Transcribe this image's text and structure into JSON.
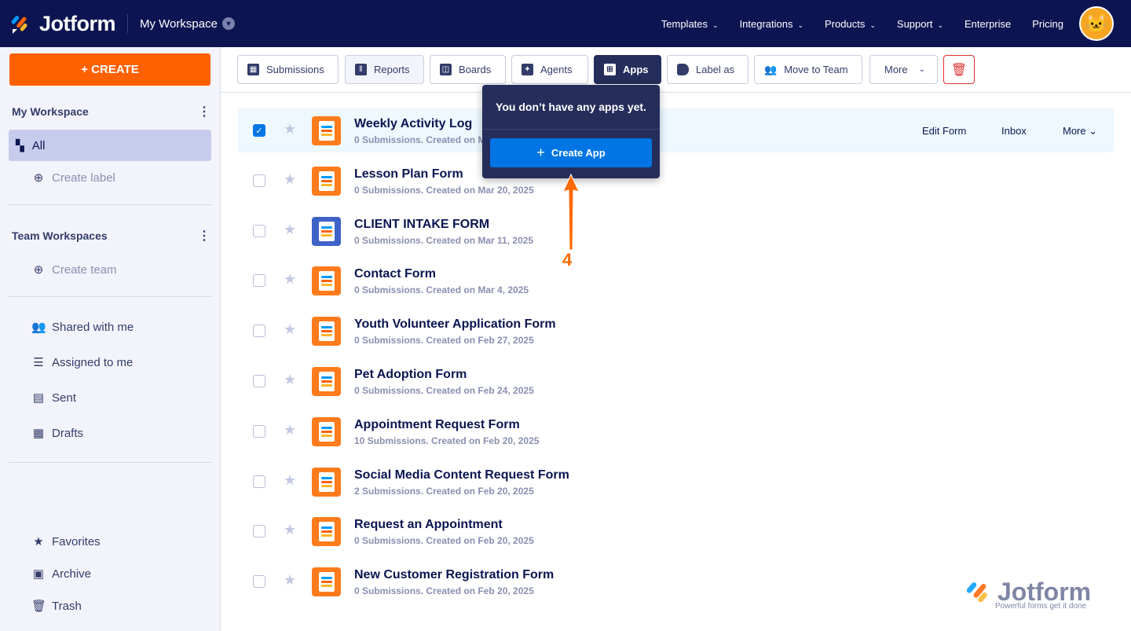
{
  "header": {
    "brand": "Jotform",
    "workspace": "My Workspace",
    "nav": [
      "Templates",
      "Integrations",
      "Products",
      "Support",
      "Enterprise",
      "Pricing"
    ],
    "nav_dropdown": [
      true,
      true,
      true,
      true,
      false,
      false
    ]
  },
  "sidebar": {
    "create": "+ CREATE",
    "my_workspace": "My Workspace",
    "all": "All",
    "create_label": "Create label",
    "team_workspaces": "Team Workspaces",
    "create_team": "Create team",
    "shared": "Shared with me",
    "assigned": "Assigned to me",
    "sent": "Sent",
    "drafts": "Drafts",
    "favorites": "Favorites",
    "archive": "Archive",
    "trash": "Trash"
  },
  "toolbar": {
    "submissions": "Submissions",
    "reports": "Reports",
    "boards": "Boards",
    "agents": "Agents",
    "apps": "Apps",
    "label_as": "Label as",
    "move_to_team": "Move to Team",
    "more": "More"
  },
  "popover": {
    "message": "You don’t have any apps yet.",
    "button": "Create App"
  },
  "annotation": {
    "step": "4"
  },
  "row_actions": {
    "edit": "Edit Form",
    "inbox": "Inbox",
    "more": "More"
  },
  "forms": [
    {
      "title": "Weekly Activity Log",
      "sub": "0 Submissions. Created on Mar 25, 2025",
      "selected": true
    },
    {
      "title": "Lesson Plan Form",
      "sub": "0 Submissions. Created on Mar 20, 2025"
    },
    {
      "title": "CLIENT INTAKE FORM",
      "sub": "0 Submissions. Created on Mar 11, 2025",
      "blue": true
    },
    {
      "title": "Contact Form",
      "sub": "0 Submissions. Created on Mar 4, 2025"
    },
    {
      "title": "Youth Volunteer Application Form",
      "sub": "0 Submissions. Created on Feb 27, 2025"
    },
    {
      "title": "Pet Adoption Form",
      "sub": "0 Submissions. Created on Feb 24, 2025"
    },
    {
      "title": "Appointment Request Form",
      "sub": "10 Submissions. Created on Feb 20, 2025"
    },
    {
      "title": "Social Media Content Request Form",
      "sub": "2 Submissions. Created on Feb 20, 2025"
    },
    {
      "title": "Request an Appointment",
      "sub": "0 Submissions. Created on Feb 20, 2025"
    },
    {
      "title": "New Customer Registration Form",
      "sub": "0 Submissions. Created on Feb 20, 2025"
    }
  ],
  "watermark": {
    "brand": "Jotform",
    "tagline": "Powerful forms get it done"
  }
}
